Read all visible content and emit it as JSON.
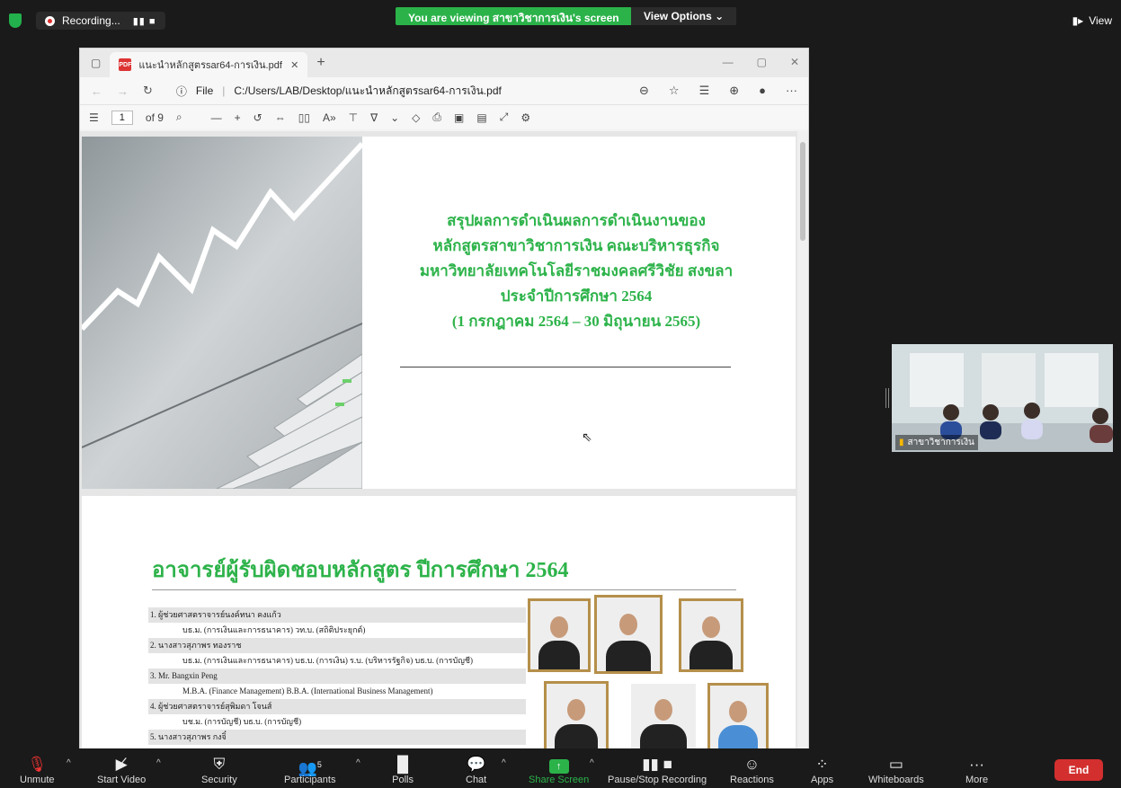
{
  "topbar": {
    "recording_label": "Recording...",
    "recording_controls": "▮▮  ■",
    "viewing_text": "You are viewing สาขาวิชาการเงิน's screen",
    "view_options": "View Options ⌄",
    "view_label": "View"
  },
  "browser": {
    "tab_title": "แนะนำหลักสูตรsar64-การเงิน.pdf",
    "url_scheme": "File",
    "url_path": "C:/Users/LAB/Desktop/แนะนำหลักสูตรsar64-การเงิน.pdf",
    "page_current": "1",
    "page_total": "of 9"
  },
  "page1": {
    "title_lines": [
      "สรุปผลการดำเนินผลการดำเนินงานของ",
      "หลักสูตรสาขาวิชาการเงิน คณะบริหารธุรกิจ",
      "มหาวิทยาลัยเทคโนโลยีราชมงคลศรีวิชัย สงขลา",
      "ประจำปีการศึกษา 2564",
      "(1 กรกฎาคม 2564 – 30 มิถุนายน 2565)"
    ]
  },
  "page2": {
    "title": "อาจารย์ผู้รับผิดชอบหลักสูตร ปีการศึกษา 2564",
    "staff": [
      {
        "text": "1. ผู้ช่วยศาสตราจารย์นงค์ทนา คงแก้ว",
        "type": "name"
      },
      {
        "text": "บธ.ม. (การเงินและการธนาคาร) วท.บ. (สถิติประยุกต์)",
        "type": "sub"
      },
      {
        "text": "2. นางสาวสุภาพร ทองราช",
        "type": "name"
      },
      {
        "text": "บธ.ม. (การเงินและการธนาคาร) บธ.บ. (การเงิน) ร.บ. (บริหารรัฐกิจ) บธ.บ. (การบัญชี)",
        "type": "sub"
      },
      {
        "text": "3. Mr. Bangxin Peng",
        "type": "name"
      },
      {
        "text": "M.B.A. (Finance Management) B.B.A. (International Business Management)",
        "type": "sub"
      },
      {
        "text": "4. ผู้ช่วยศาสตราจารย์สุพิมดา โจนส์",
        "type": "name"
      },
      {
        "text": "บช.ม. (การบัญชี) บธ.บ. (การบัญชี)",
        "type": "sub"
      },
      {
        "text": "5. นางสาวสุภาพร กงจิ๋",
        "type": "name"
      }
    ]
  },
  "participant": {
    "name": "สาขาวิชาการเงิน"
  },
  "toolbar": {
    "unmute": "Unmute",
    "start_video": "Start Video",
    "security": "Security",
    "participants": "Participants",
    "participants_count": "5",
    "polls": "Polls",
    "chat": "Chat",
    "share_screen": "Share Screen",
    "pause_recording": "Pause/Stop Recording",
    "reactions": "Reactions",
    "apps": "Apps",
    "whiteboards": "Whiteboards",
    "more": "More",
    "end": "End"
  },
  "colors": {
    "accent_green": "#2bb34a",
    "title_green": "#2db34a",
    "end_red": "#d32f2f",
    "photo_frame": "#b58f4a"
  }
}
